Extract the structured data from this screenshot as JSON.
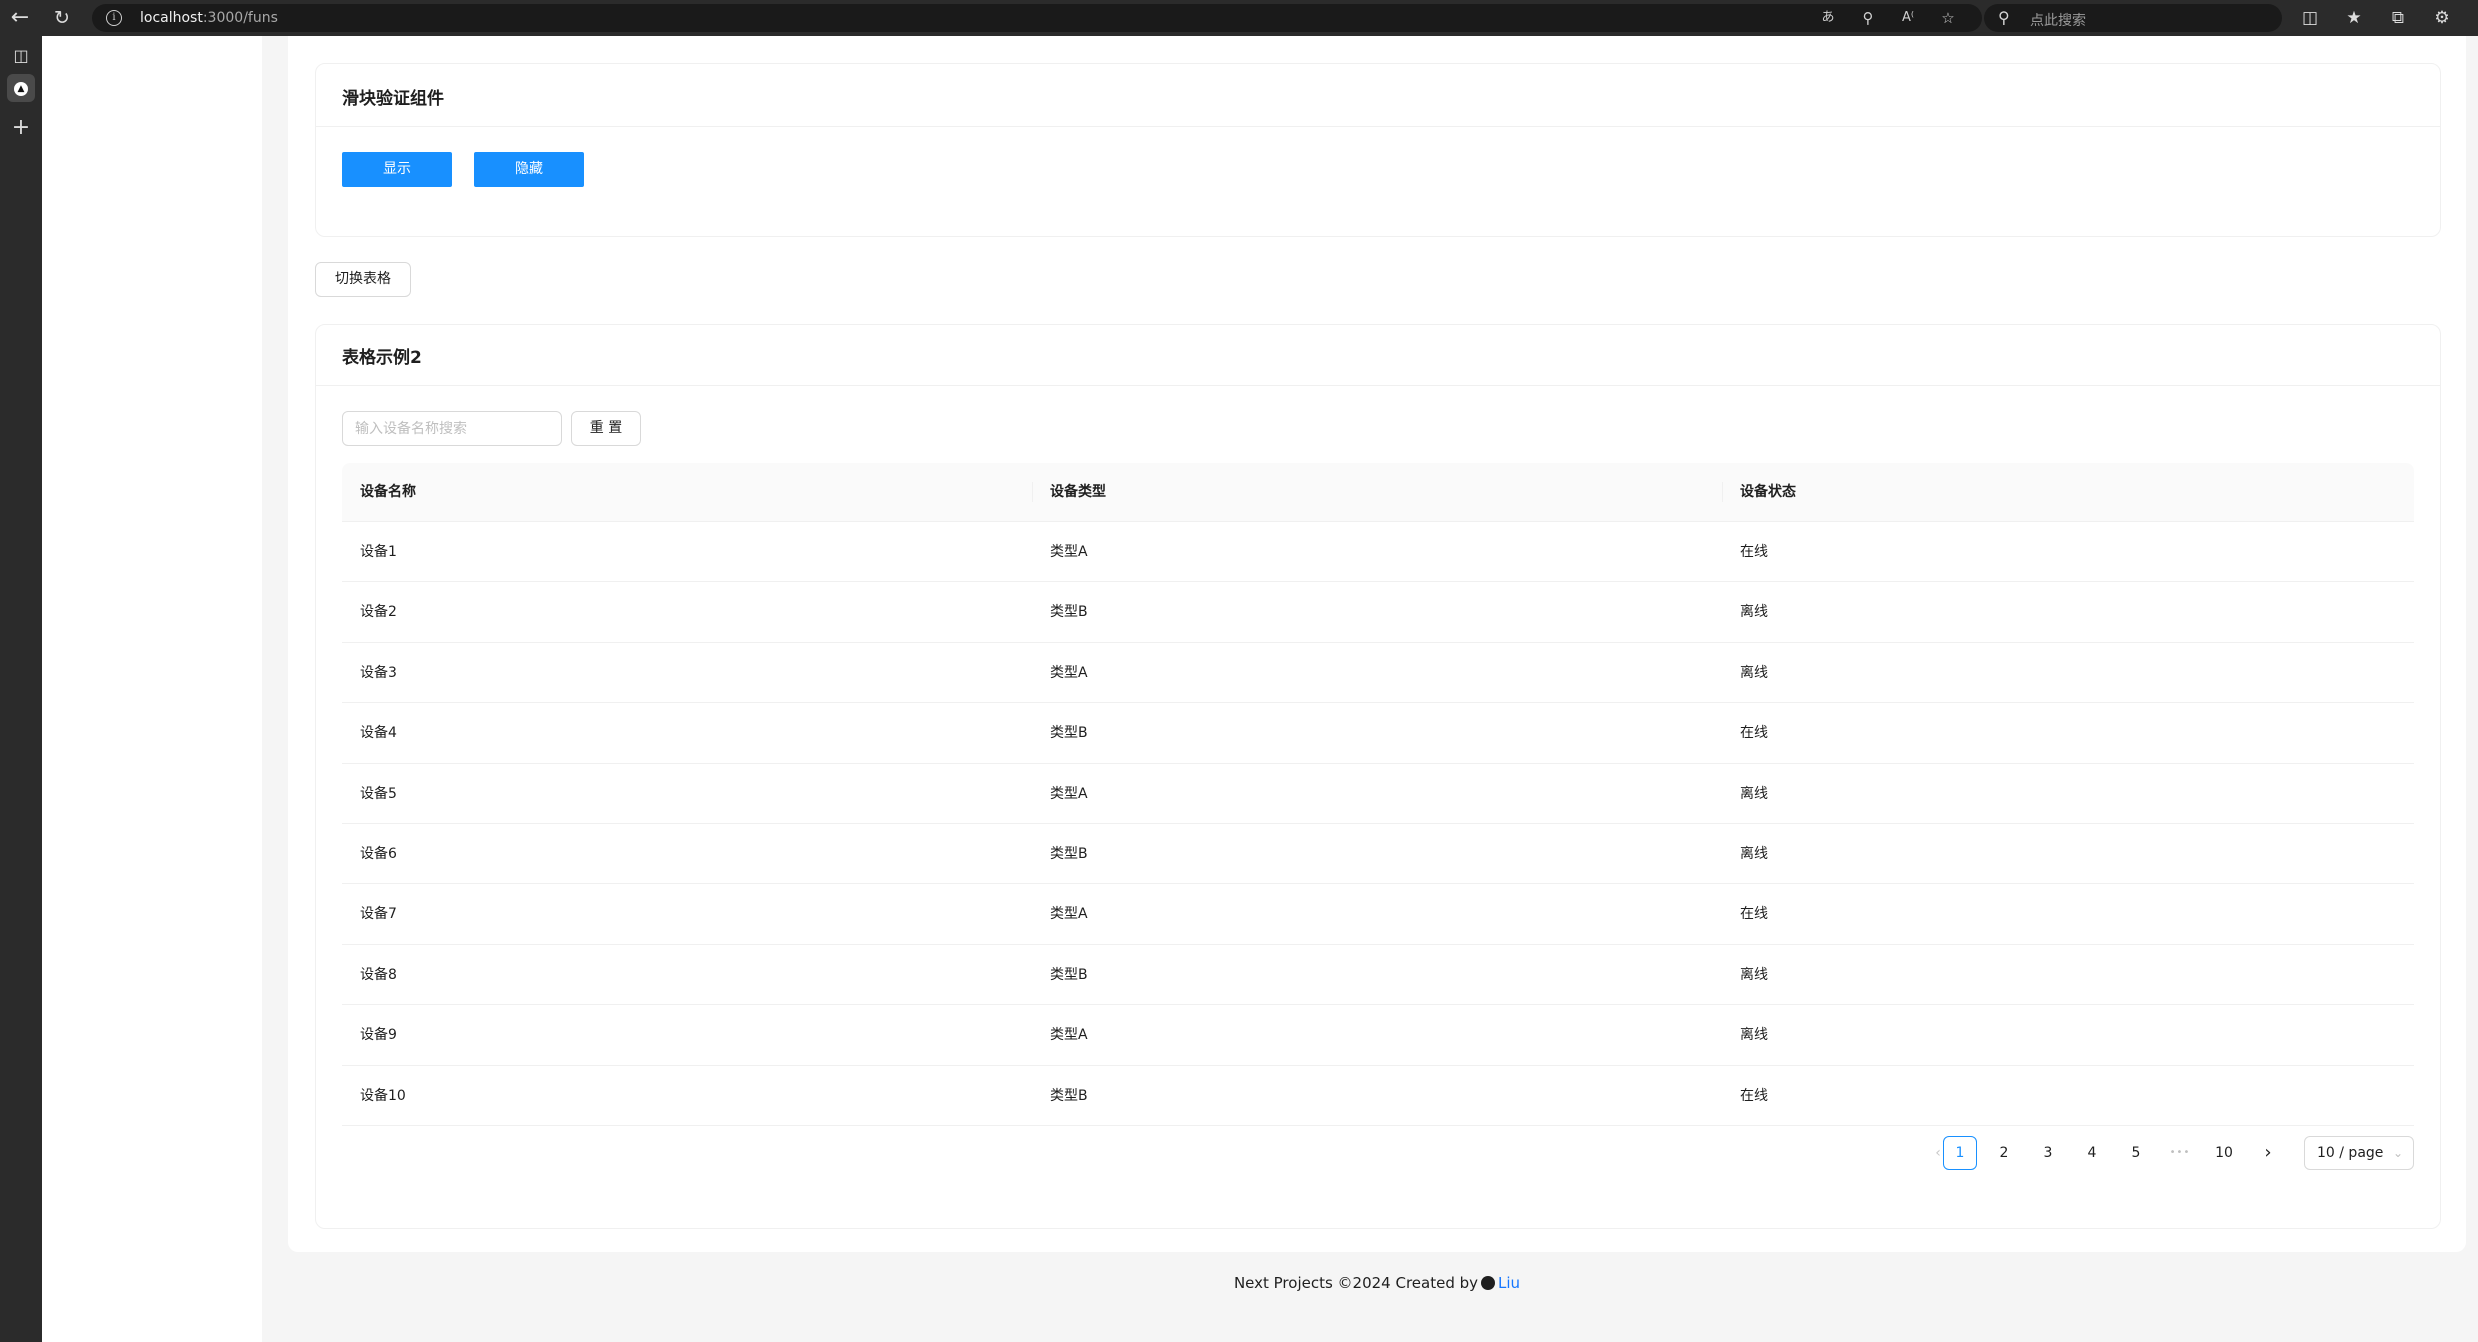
{
  "browser": {
    "url_host": "localhost",
    "url_path": ":3000/funs",
    "search_placeholder": "点此搜索",
    "icons": [
      "back-icon",
      "refresh-icon",
      "site-info-icon",
      "translate-icon",
      "zoom-icon",
      "read-aloud-icon",
      "favorite-star-icon",
      "split-screen-icon",
      "favorites-icon",
      "collections-icon",
      "extensions-icon"
    ]
  },
  "sidebar_rail": {
    "icons": [
      "tab-actions-icon",
      "app-icon",
      "add-icon"
    ]
  },
  "slider_card": {
    "title": "滑块验证组件",
    "show_label": "显示",
    "hide_label": "隐藏"
  },
  "toggle_table_label": "切换表格",
  "table_card": {
    "title": "表格示例2",
    "search_placeholder": "输入设备名称搜索",
    "reset_label": "重 置",
    "columns": [
      "设备名称",
      "设备类型",
      "设备状态"
    ],
    "rows": [
      {
        "name": "设备1",
        "type": "类型A",
        "status": "在线"
      },
      {
        "name": "设备2",
        "type": "类型B",
        "status": "离线"
      },
      {
        "name": "设备3",
        "type": "类型A",
        "status": "离线"
      },
      {
        "name": "设备4",
        "type": "类型B",
        "status": "在线"
      },
      {
        "name": "设备5",
        "type": "类型A",
        "status": "离线"
      },
      {
        "name": "设备6",
        "type": "类型B",
        "status": "离线"
      },
      {
        "name": "设备7",
        "type": "类型A",
        "status": "在线"
      },
      {
        "name": "设备8",
        "type": "类型B",
        "status": "离线"
      },
      {
        "name": "设备9",
        "type": "类型A",
        "status": "离线"
      },
      {
        "name": "设备10",
        "type": "类型B",
        "status": "在线"
      }
    ]
  },
  "pagination": {
    "pages": [
      "1",
      "2",
      "3",
      "4",
      "5"
    ],
    "ellipsis": "•••",
    "last_page": "10",
    "current": "1",
    "page_size": "10 / page"
  },
  "footer": {
    "text": "Next Projects ©2024 Created by",
    "author": "Liu"
  },
  "colors": {
    "primary": "#1890ff",
    "link": "#1677ff"
  }
}
